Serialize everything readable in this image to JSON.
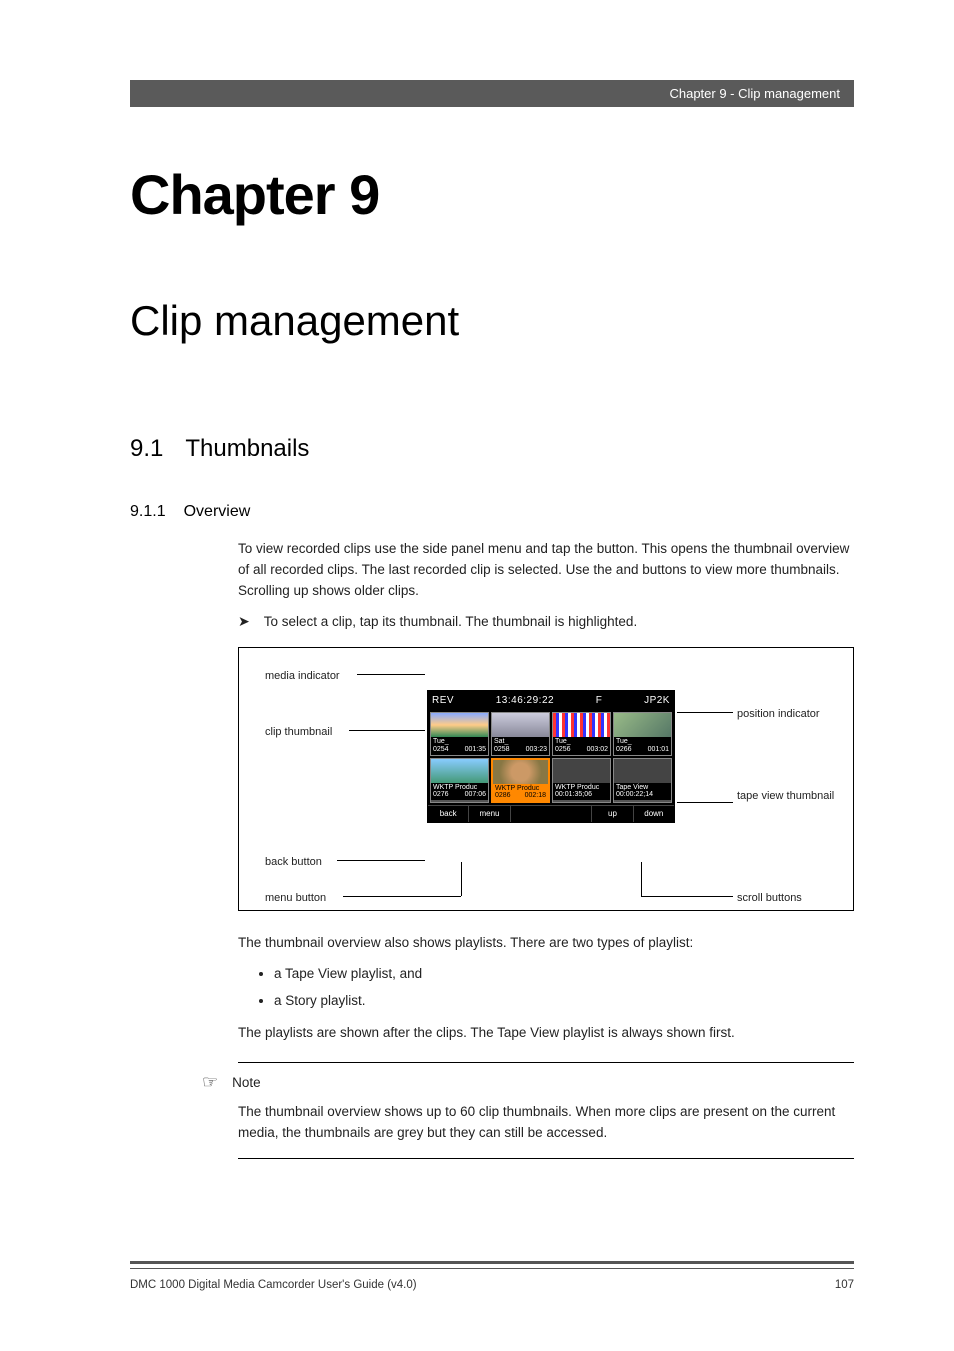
{
  "header": {
    "breadcrumb": "Chapter 9 - Clip management"
  },
  "chapter": {
    "number": "Chapter 9",
    "title": "Clip management"
  },
  "section": {
    "num": "9.1",
    "title": "Thumbnails"
  },
  "subsection": {
    "num": "9.1.1",
    "title": "Overview"
  },
  "para1": "To view recorded clips use the side panel menu and tap the           button. This opens the thumbnail overview of all recorded clips. The last recorded clip is selected. Use the       and           buttons to view more thumbnails. Scrolling up shows older clips.",
  "arrowline": "To select a clip, tap its thumbnail. The thumbnail is highlighted.",
  "diagram": {
    "labels": {
      "media_indicator": "media indicator",
      "clip_thumbnail": "clip thumbnail",
      "back_button": "back button",
      "menu_button": "menu button",
      "position_indicator": "position indicator",
      "tape_view_thumbnail": "tape view thumbnail",
      "scroll_buttons": "scroll buttons"
    },
    "screen": {
      "top": {
        "rev": "REV",
        "tc": "13:46:29:22",
        "f": "F",
        "codec": "JP2K"
      },
      "thumbs": [
        {
          "name": "Tue_",
          "id": "0254",
          "dur": "001:35"
        },
        {
          "name": "Sat_",
          "id": "0258",
          "dur": "003:23"
        },
        {
          "name": "Tue_",
          "id": "0256",
          "dur": "003:02"
        },
        {
          "name": "Tue_",
          "id": "0266",
          "dur": "001:01"
        },
        {
          "name": "WKTP Produc",
          "id": "0276",
          "dur": "007:06"
        },
        {
          "name": "WKTP Produc",
          "id": "0286",
          "dur": "002:18"
        },
        {
          "name": "WKTP Produc",
          "id": "",
          "dur": "00:01:35;06"
        },
        {
          "name": "Tape View",
          "id": "",
          "dur": "00:00:22;14"
        }
      ],
      "buttons": {
        "back": "back",
        "menu": "menu",
        "up": "up",
        "down": "down"
      }
    }
  },
  "para2": "The thumbnail overview also shows playlists. There are two types of playlist:",
  "bullets": [
    "a Tape View playlist, and",
    "a Story playlist."
  ],
  "para3": "The playlists are shown after the clips. The Tape View playlist is always shown first.",
  "note": {
    "label": "Note",
    "body": "The thumbnail overview shows up to 60 clip thumbnails. When more clips are present on the current media, the thumbnails are grey but they can still be accessed."
  },
  "footer": {
    "left": "DMC 1000 Digital Media Camcorder User's Guide (v4.0)",
    "right": "107"
  }
}
